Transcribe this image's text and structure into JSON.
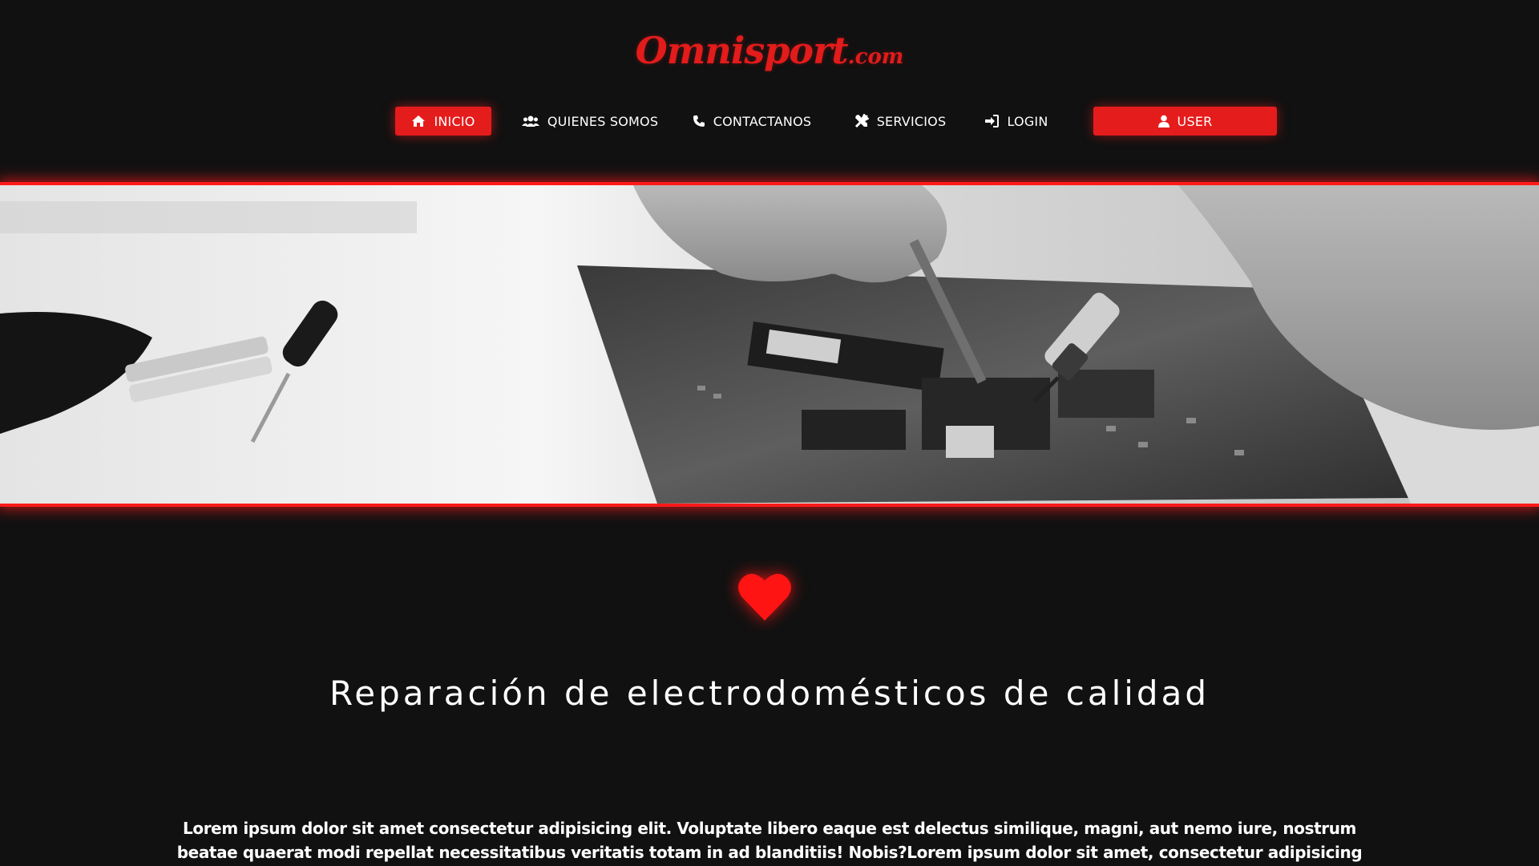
{
  "brand": {
    "name": "Omnisport",
    "suffix": ".com",
    "color": "#e21b1b"
  },
  "nav": {
    "items": [
      {
        "label": "INICIO",
        "icon": "home-icon",
        "active": true
      },
      {
        "label": "QUIENES SOMOS",
        "icon": "users-icon",
        "active": false
      },
      {
        "label": "CONTACTANOS",
        "icon": "phone-icon",
        "active": false
      },
      {
        "label": "SERVICIOS",
        "icon": "tools-icon",
        "active": false
      },
      {
        "label": "LOGIN",
        "icon": "sign-in-icon",
        "active": false
      }
    ],
    "user_button": {
      "label": "USER",
      "icon": "user-icon"
    }
  },
  "hero": {
    "icon": "electronics-repair-photo"
  },
  "feature": {
    "icon": "heart-icon",
    "headline": "Reparación de electrodomésticos de calidad",
    "body": "Lorem ipsum dolor sit amet consectetur adipisicing elit. Voluptate libero eaque est delectus similique, magni, aut nemo iure, nostrum beatae quaerat modi repellat necessitatibus veritatis totam in ad blanditiis! Nobis?Lorem ipsum dolor sit amet, consectetur adipisicing elit. Et nam facere adipisci!"
  },
  "colors": {
    "accent": "#e51c1c",
    "background": "#111111",
    "text": "#ffffff"
  }
}
